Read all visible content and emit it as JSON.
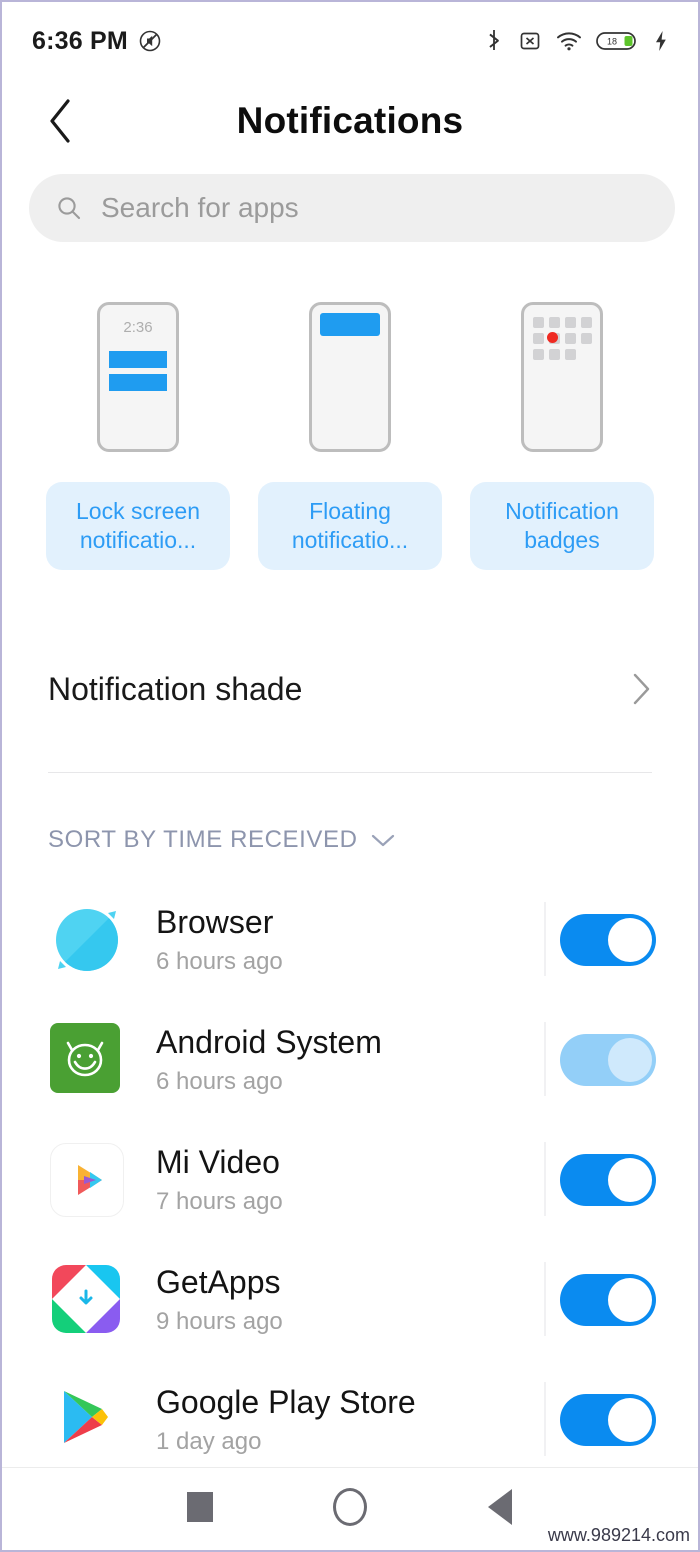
{
  "status_bar": {
    "time": "6:36 PM",
    "left_icons": [
      "mute-icon"
    ],
    "right_icons": [
      "bluetooth-icon",
      "sim-disabled-icon",
      "wifi-icon",
      "battery-icon",
      "charging-bolt-icon"
    ],
    "battery_level": "18"
  },
  "header": {
    "title": "Notifications",
    "back_icon": "chevron-left-icon"
  },
  "search": {
    "placeholder": "Search for apps",
    "icon": "search-icon"
  },
  "shortcut_cards": [
    {
      "label": "Lock screen notificatio...",
      "illustration": "lock-screen-phone",
      "illustration_time": "2:36"
    },
    {
      "label": "Floating notificatio...",
      "illustration": "floating-notification-phone"
    },
    {
      "label": "Notification badges",
      "illustration": "badges-phone"
    }
  ],
  "shade_row": {
    "label": "Notification shade",
    "chevron": "chevron-right-icon"
  },
  "sort": {
    "label": "SORT BY TIME RECEIVED",
    "chevron": "chevron-down-icon"
  },
  "apps": [
    {
      "name": "Browser",
      "time": "6 hours ago",
      "icon": "browser-icon",
      "toggle": "on"
    },
    {
      "name": "Android System",
      "time": "6 hours ago",
      "icon": "android-system-icon",
      "toggle": "on-disabled"
    },
    {
      "name": "Mi Video",
      "time": "7 hours ago",
      "icon": "mi-video-icon",
      "toggle": "on"
    },
    {
      "name": "GetApps",
      "time": "9 hours ago",
      "icon": "getapps-icon",
      "toggle": "on"
    },
    {
      "name": "Google Play Store",
      "time": "1 day ago",
      "icon": "google-play-icon",
      "toggle": "on"
    }
  ],
  "navbar": {
    "recents": "square-recents-icon",
    "home": "circle-home-icon",
    "back": "triangle-back-icon"
  },
  "watermark": "www.989214.com",
  "colors": {
    "accent_blue": "#0a8bf0",
    "chip_bg": "#e2f1fd",
    "chip_text": "#2d9cf5",
    "sort_text": "#8d95ad",
    "badge_red": "#ef2a22"
  }
}
